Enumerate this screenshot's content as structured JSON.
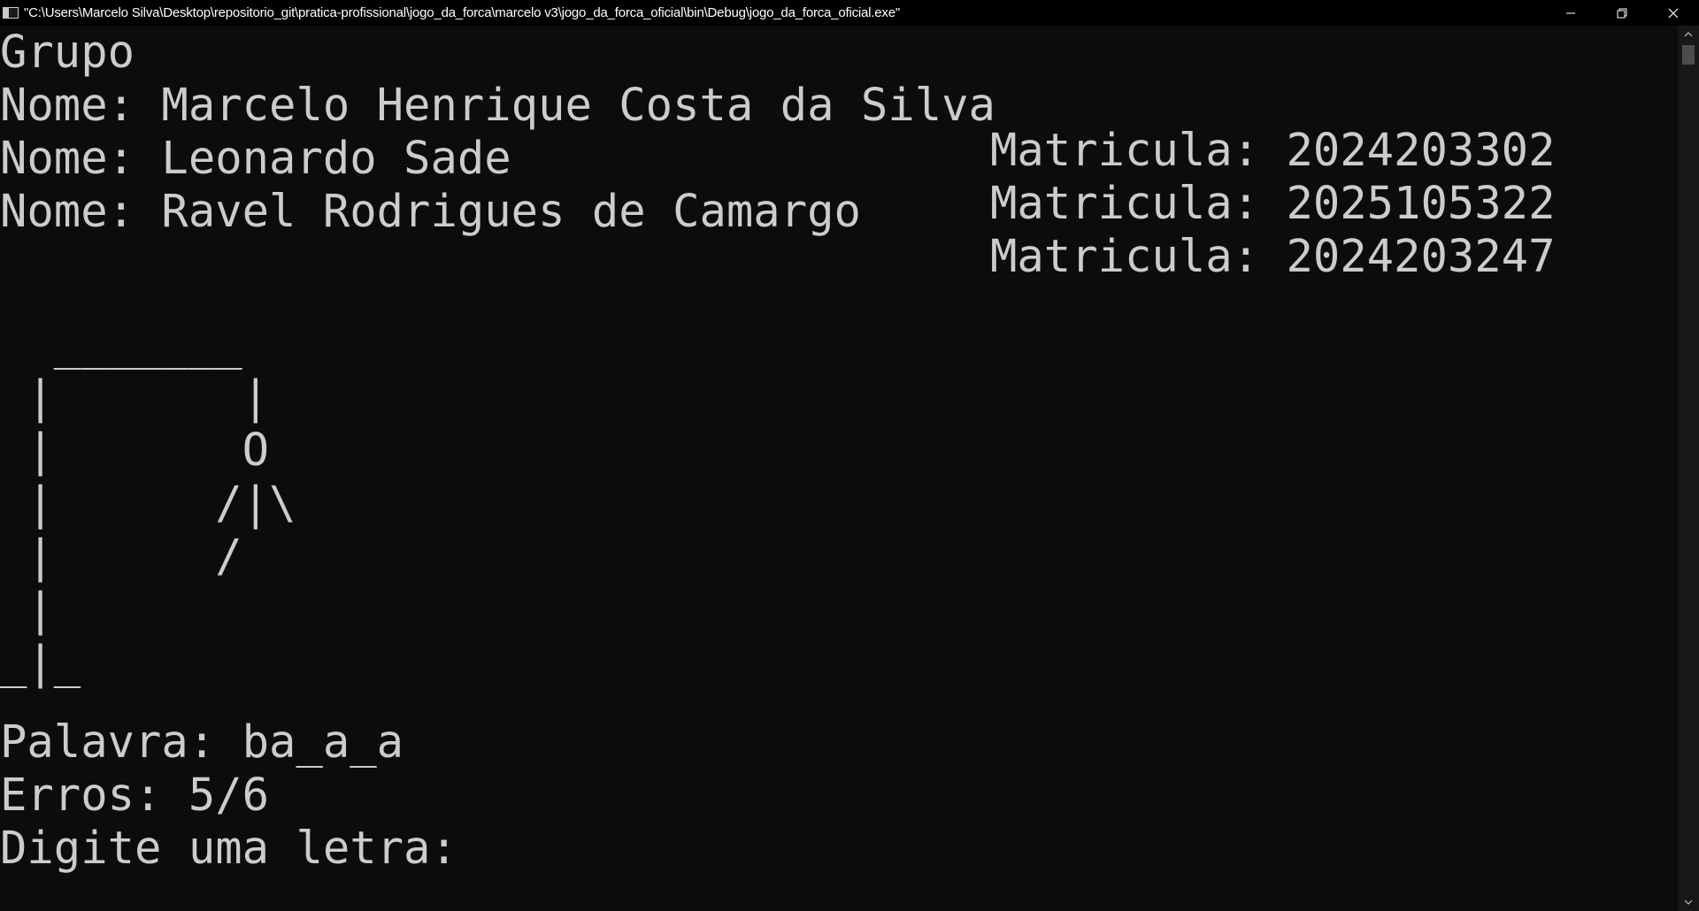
{
  "window": {
    "title": "\"C:\\Users\\Marcelo Silva\\Desktop\\repositorio_git\\pratica-profissional\\jogo_da_forca\\marcelo v3\\jogo_da_forca_oficial\\bin\\Debug\\jogo_da_forca_oficial.exe\"",
    "icons": {
      "app": "console-app-icon",
      "minimize": "minimize-icon",
      "restore": "restore-icon",
      "close": "close-icon"
    }
  },
  "console": {
    "header": "Grupo",
    "members": [
      {
        "name": "Nome: Marcelo Henrique Costa da Silva",
        "registration": "Matricula: 2024203302"
      },
      {
        "name": "Nome: Leonardo Sade",
        "registration": "Matricula: 2025105322"
      },
      {
        "name": "Nome: Ravel Rodrigues de Camargo",
        "registration": "Matricula: 2024203247"
      }
    ],
    "gallows": [
      "  _______",
      " |       |",
      " |       O",
      " |      /|\\",
      " |      /",
      " |",
      "_|_"
    ],
    "word_line": "Palavra: ba_a_a",
    "errors_line": "Erros: 5/6",
    "prompt_line": "Digite uma letra:"
  },
  "game": {
    "word_mask": "ba_a_a",
    "errors": 5,
    "max_errors": 6
  },
  "colors": {
    "background": "#0c0c0c",
    "text": "#cccccc",
    "titlebar": "#000000"
  }
}
